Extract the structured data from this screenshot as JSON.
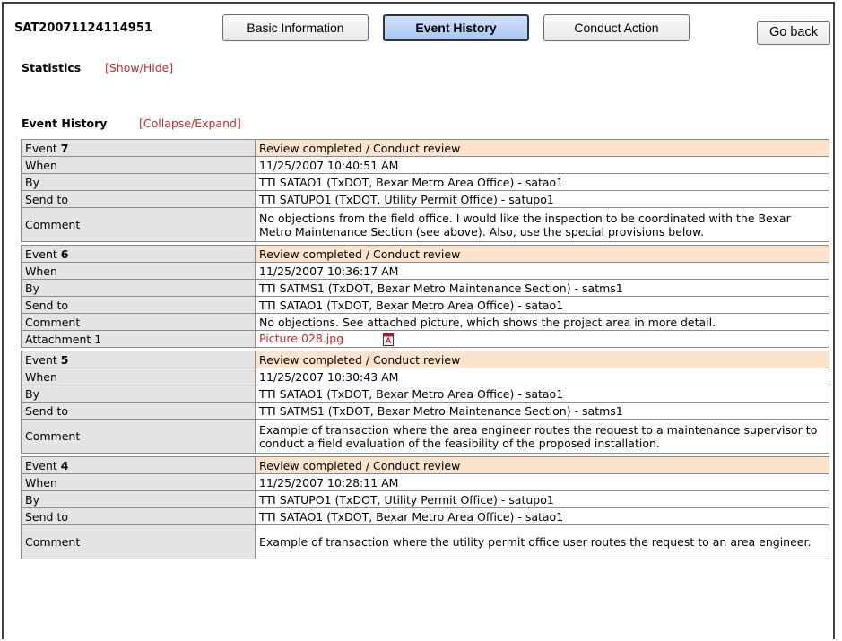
{
  "record_id": "SAT20071124114951",
  "nav": {
    "basic_info": "Basic Information",
    "event_history": "Event History",
    "conduct_action": "Conduct Action",
    "go_back": "Go back"
  },
  "statistics": {
    "label": "Statistics",
    "toggle": "[Show/Hide]"
  },
  "event_history": {
    "label": "Event History",
    "toggle": "[Collapse/Expand]"
  },
  "colors": {
    "header_row": "#fce4cc",
    "label_cell": "#e4e4e4",
    "link": "#cc2a2a",
    "active_tab": "#a9c8f2"
  },
  "events": [
    {
      "event_prefix": "Event",
      "number": "7",
      "status": "Review completed / Conduct review",
      "when_label": "When",
      "when": "11/25/2007 10:40:51 AM",
      "by_label": "By",
      "by": "TTI SATAO1 (TxDOT, Bexar Metro Area Office) - satao1",
      "send_label": "Send to",
      "send_to": "TTI SATUPO1 (TxDOT, Utility Permit Office) - satupo1",
      "comment_label": "Comment",
      "comment": "No objections from the field office. I would like the inspection to be coordinated with the Bexar Metro Maintenance Section (see above). Also, use the special provisions below."
    },
    {
      "event_prefix": "Event",
      "number": "6",
      "status": "Review completed / Conduct review",
      "when_label": "When",
      "when": "11/25/2007 10:36:17 AM",
      "by_label": "By",
      "by": "TTI SATMS1 (TxDOT, Bexar Metro Maintenance Section) - satms1",
      "send_label": "Send to",
      "send_to": "TTI SATAO1 (TxDOT, Bexar Metro Area Office) - satao1",
      "comment_label": "Comment",
      "comment": "No objections. See attached picture, which shows the project area in more detail.",
      "attachment_label": "Attachment 1",
      "attachment": "Picture 028.jpg",
      "attachment_icon": "pdf-icon"
    },
    {
      "event_prefix": "Event",
      "number": "5",
      "status": "Review completed / Conduct review",
      "when_label": "When",
      "when": "11/25/2007 10:30:43 AM",
      "by_label": "By",
      "by": "TTI SATAO1 (TxDOT, Bexar Metro Area Office) - satao1",
      "send_label": "Send to",
      "send_to": "TTI SATMS1 (TxDOT, Bexar Metro Maintenance Section) - satms1",
      "comment_label": "Comment",
      "comment": "Example of transaction where the area engineer routes the request to a maintenance supervisor to conduct a field evaluation of the feasibility of the proposed installation."
    },
    {
      "event_prefix": "Event",
      "number": "4",
      "status": "Review completed / Conduct review",
      "when_label": "When",
      "when": "11/25/2007 10:28:11 AM",
      "by_label": "By",
      "by": "TTI SATUPO1 (TxDOT, Utility Permit Office) - satupo1",
      "send_label": "Send to",
      "send_to": "TTI SATAO1 (TxDOT, Bexar Metro Area Office) - satao1",
      "comment_label": "Comment",
      "comment": "Example of transaction where the utility permit office user routes the request to an area engineer."
    }
  ]
}
